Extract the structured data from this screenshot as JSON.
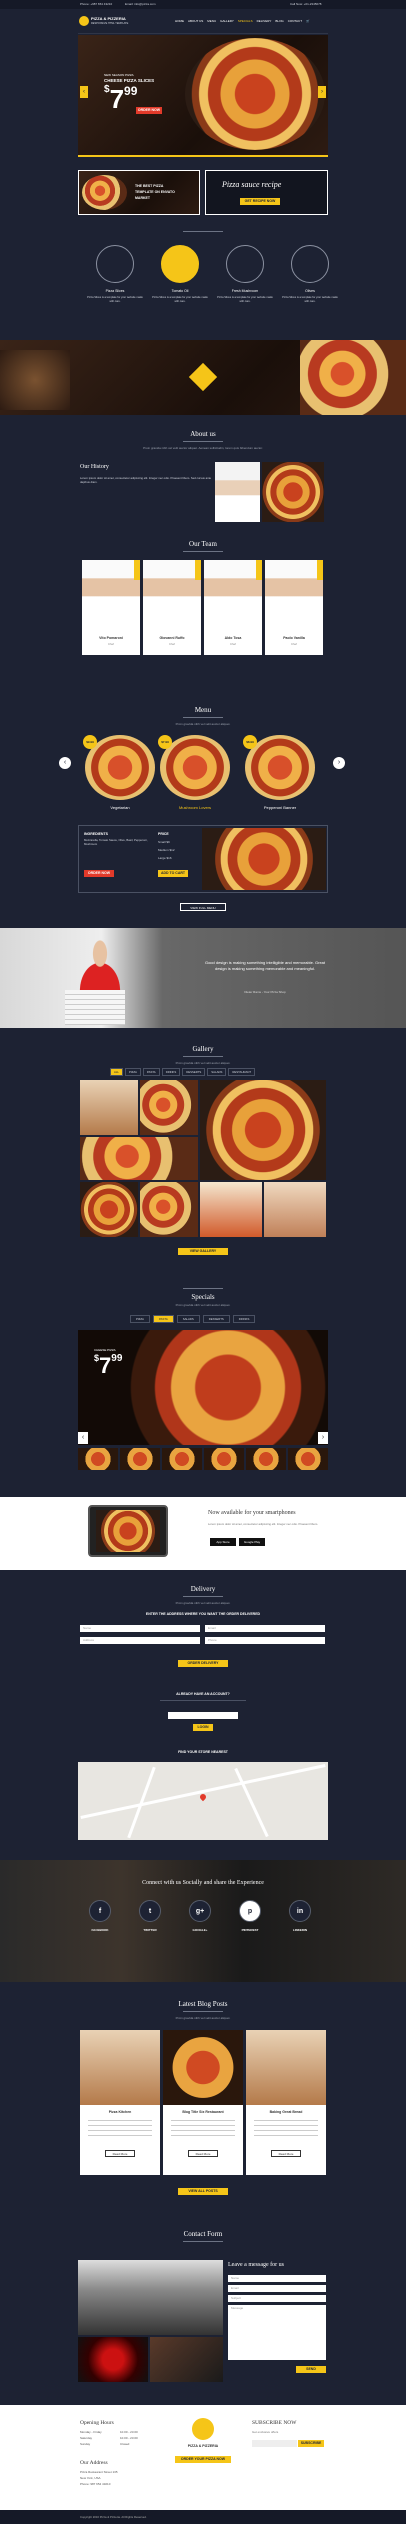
{
  "topbar": {
    "phone": "Phone: +987 654 43210",
    "email": "Email: info@pizza.com",
    "right_info": "Call Now: +01-2345678"
  },
  "nav": {
    "logo": "PIZZA & PIZZERIA",
    "logo_sub": "RESPONSIVE HTML TEMPLATE",
    "items": [
      "HOME",
      "ABOUT US",
      "MENU",
      "GALLERY",
      "SPECIALS",
      "DELIVERY",
      "BLOG",
      "CONTACT"
    ]
  },
  "hero": {
    "kicker": "NEW SEASON PIZZA",
    "title": "CHEESE PIZZA SLICES",
    "price_sym": "$",
    "price": "7",
    "cents": "99",
    "btn": "ORDER NOW"
  },
  "promo": {
    "left_title": "THE BEST PIZZA",
    "left_sub": "TEMPLATE ON ENVATO",
    "left_sub2": "MARKET",
    "right_title": "Pizza sauce recipe",
    "right_btn": "GET RECIPE NOW"
  },
  "features": [
    {
      "label": "Pizza Slices",
      "icon": "pizza-slice-icon"
    },
    {
      "label": "Tomato Oil",
      "icon": "tomato-oil-icon"
    },
    {
      "label": "Fresh Mushroom",
      "icon": "mushroom-icon"
    },
    {
      "label": "Olives",
      "icon": "olives-icon"
    }
  ],
  "feature_text": "Pizza Slices is a template for your website made with care.",
  "about": {
    "title": "About us",
    "sub": "Proin gravida nibh vel velit auctor aliquet. Aenean sollicitudin, lorem quis bibendum auctor.",
    "history_title": "Our History",
    "history_text": "Lorem ipsum dolor sit amet, consectetur adipiscing elit. Integer nec odio. Praesent libero. Sed cursus ante dapibus diam."
  },
  "team": {
    "title": "Our Team",
    "members": [
      {
        "name": "Vito Pomaroni",
        "role": "Chef"
      },
      {
        "name": "Giovanni Ruffo",
        "role": "Chef"
      },
      {
        "name": "Aldo Tosa",
        "role": "Chef"
      },
      {
        "name": "Paolo Vanilla",
        "role": "Chef"
      }
    ]
  },
  "menu": {
    "title": "Menu",
    "sub": "Proin gravida nibh vel velit auctor aliquet.",
    "cats": [
      "Vegetarian",
      "Mushroom Lovers",
      "Pepperoni Banner"
    ],
    "prices": [
      "$9.99",
      "$7.99",
      "$8.99"
    ],
    "ingredients_title": "INGREDIENTS",
    "ingredients": "Mozzarella, Tomato Sauce, Olive, Basil, Pepperoni, Mushroom",
    "price_label": "PRICE",
    "prices_list": [
      "Small $9",
      "Medium $12",
      "Large $16"
    ],
    "order_btn": "ORDER NOW",
    "cart_btn": "ADD TO CART",
    "view_btn": "VIEW FULL MENU"
  },
  "quote": {
    "text": "Good design is making something intelligible and memorable. Great design is making something memorable and meaningful.",
    "author": "Dieter Rams - Your Pizza Shop"
  },
  "gallery": {
    "title": "Gallery",
    "sub": "Proin gravida nibh vel velit auctor aliquet.",
    "filters": [
      "ALL",
      "PIZZA",
      "PASTA",
      "DRINKS",
      "DESSERTS",
      "SALADS",
      "RESTAURANT"
    ],
    "btn": "VIEW GALLERY"
  },
  "specials": {
    "title": "Specials",
    "sub": "Proin gravida nibh vel velit auctor aliquet.",
    "tabs": [
      "PIZZA",
      "PASTA",
      "SALADS",
      "DESSERTS",
      "DRINKS"
    ],
    "kicker": "CHEESE PIZZA",
    "price_sym": "$",
    "price": "7",
    "cents": "99"
  },
  "app": {
    "title": "Now available for your smartphones",
    "text": "Lorem ipsum dolor sit amet, consectetur adipiscing elit. Integer nec odio. Praesent libero.",
    "btn1": "App Store",
    "btn2": "Google Play"
  },
  "delivery": {
    "title": "Delivery",
    "sub": "Proin gravida nibh vel velit auctor aliquet.",
    "heading": "ENTER THE ADDRESS WHERE YOU WANT THE ORDER DELIVERED",
    "fields": [
      "Name",
      "Email",
      "Address",
      "Phone"
    ],
    "btn": "ORDER DELIVERY",
    "account_title": "ALREADY HAVE AN ACCOUNT?",
    "login_btn": "LOGIN",
    "store_title": "FIND YOUR STORE NEAREST"
  },
  "social": {
    "title": "Connect with us Socially and share the Experience",
    "items": [
      {
        "label": "FACEBOOK",
        "glyph": "f"
      },
      {
        "label": "TWITTER",
        "glyph": "t"
      },
      {
        "label": "GOOGLE+",
        "glyph": "g+"
      },
      {
        "label": "PINTEREST",
        "glyph": "p"
      },
      {
        "label": "LINKEDIN",
        "glyph": "in"
      }
    ]
  },
  "blog": {
    "title": "Latest Blog Posts",
    "sub": "Proin gravida nibh vel velit auctor aliquet.",
    "posts": [
      {
        "title": "Pizza Kitchen",
        "btn": "Read More"
      },
      {
        "title": "Blog Title Six Restaurant",
        "btn": "Read More"
      },
      {
        "title": "Baking Great Bread",
        "btn": "Read More"
      }
    ],
    "btn": "VIEW ALL POSTS"
  },
  "contact": {
    "title": "Contact Form",
    "form_title": "Leave a message for us",
    "fields": [
      "Name",
      "Email",
      "Subject",
      "Message"
    ],
    "btn": "SEND"
  },
  "footer": {
    "hours_title": "Opening Hours",
    "hours": [
      "Monday - Friday",
      "10.00 - 23.00",
      "Saturday",
      "10.00 - 23.00",
      "Sunday",
      "Closed"
    ],
    "address_title": "Our Address",
    "address": [
      "Pizza Restaurant Street 135",
      "New York, USA",
      "Phone: 987 654 43210"
    ],
    "subscribe_title": "SUBSCRIBE NOW",
    "sub_text": "Get exclusive offers",
    "sub_btn": "SUBSCRIBE",
    "logo": "PIZZA & PIZZERIA",
    "bottom_btn": "ORDER YOUR PIZZA NOW",
    "copyright": "Copyright 2016 Pizza & Pizzeria. All Rights Reserved."
  },
  "colors": {
    "bg": "#1d2233",
    "accent": "#f5c518",
    "red": "#e23a2a"
  }
}
